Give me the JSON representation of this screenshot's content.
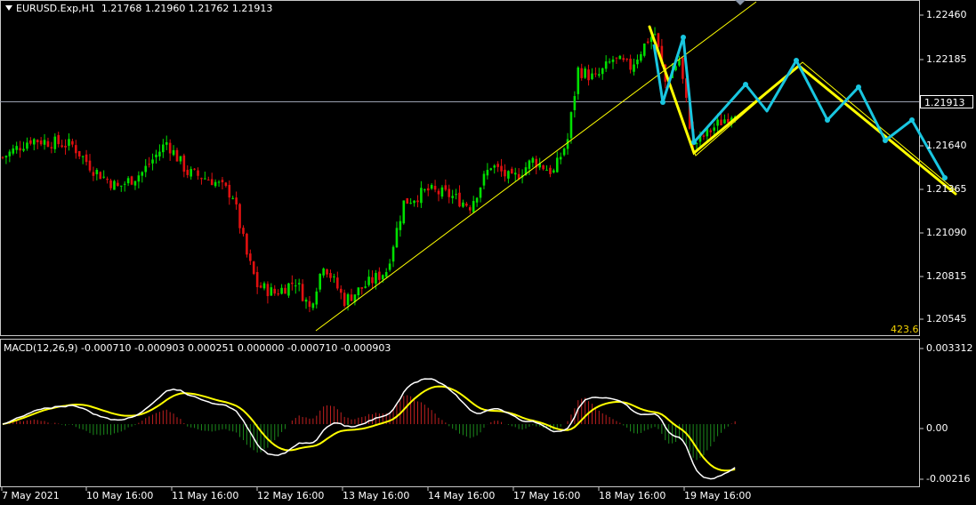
{
  "symbol_header": {
    "symbol": "EURUSD.Exp,H1",
    "open": "1.21768",
    "high": "1.21960",
    "low": "1.21762",
    "close": "1.21913"
  },
  "macd_header": {
    "name": "MACD(12,26,9)",
    "values": "-0.000710 -0.000903 0.000251 0.000000 -0.000710 -0.000903"
  },
  "price_axis": [
    "1.22460",
    "1.22185",
    "1.21640",
    "1.21365",
    "1.21090",
    "1.20815",
    "1.20545"
  ],
  "current_price": "1.21913",
  "fib_label": "423.6",
  "macd_axis": [
    "0.003312",
    "0.00",
    "-0.00216"
  ],
  "time_axis": [
    "7 May 2021",
    "10 May 16:00",
    "11 May 16:00",
    "12 May 16:00",
    "13 May 16:00",
    "14 May 16:00",
    "17 May 16:00",
    "18 May 16:00",
    "19 May 16:00"
  ],
  "colors": {
    "bull": "#00e000",
    "bear": "#e01010",
    "macd_main": "#ffffff",
    "macd_signal": "#ffff00",
    "trend": "#ffff00",
    "projection": "#19c6e0",
    "background": "#000000",
    "grid_frame": "#c8c8c8"
  },
  "chart_data": {
    "type": "candlestick",
    "price_range": [
      1.2045,
      1.2262
    ],
    "key_prices": {
      "start": 1.2172,
      "low_12may": 1.2053,
      "high_18may": 1.2246,
      "current": 1.21913
    },
    "macd_range": [
      -0.0025,
      0.0034
    ]
  }
}
